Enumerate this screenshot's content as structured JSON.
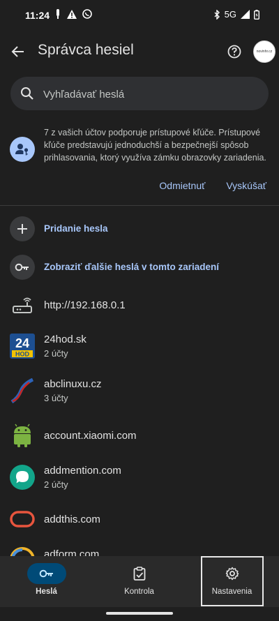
{
  "status_bar": {
    "time": "11:24",
    "network": "5G"
  },
  "app_bar": {
    "title": "Správca hesiel",
    "avatar_text": "novinhr.cz"
  },
  "search": {
    "placeholder": "Vyhľadávať heslá"
  },
  "promo": {
    "text": "7 z vašich účtov podporuje prístupové kľúče. Prístupové kľúče predstavujú jednoduchší a bezpečnejší spôsob prihlasovania, ktorý využíva zámku obrazovky zariadenia.",
    "dismiss_label": "Odmietnuť",
    "try_label": "Vyskúšať",
    "accent_color": "#a8c7fa"
  },
  "actions": [
    {
      "label": "Pridanie hesla",
      "icon": "plus-icon"
    },
    {
      "label": "Zobraziť ďalšie heslá v tomto zariadení",
      "icon": "key-icon"
    }
  ],
  "sites": [
    {
      "name": "http://192.168.0.1",
      "sub": "",
      "icon": "router-icon"
    },
    {
      "name": "24hod.sk",
      "sub": "2 účty",
      "icon": "24hod-logo-icon"
    },
    {
      "name": "abclinuxu.cz",
      "sub": "3 účty",
      "icon": "abclinuxu-logo-icon"
    },
    {
      "name": "account.xiaomi.com",
      "sub": "",
      "icon": "android-icon"
    },
    {
      "name": "addmention.com",
      "sub": "2 účty",
      "icon": "chat-bubble-icon"
    },
    {
      "name": "addthis.com",
      "sub": "",
      "icon": "addthis-logo-icon"
    },
    {
      "name": "adform.com",
      "sub": "",
      "icon": "adform-logo-icon"
    }
  ],
  "bottom_nav": [
    {
      "label": "Heslá",
      "icon": "key-icon",
      "active": true
    },
    {
      "label": "Kontrola",
      "icon": "clipboard-check-icon",
      "active": false
    },
    {
      "label": "Nastavenia",
      "icon": "gear-icon",
      "active": false
    }
  ]
}
